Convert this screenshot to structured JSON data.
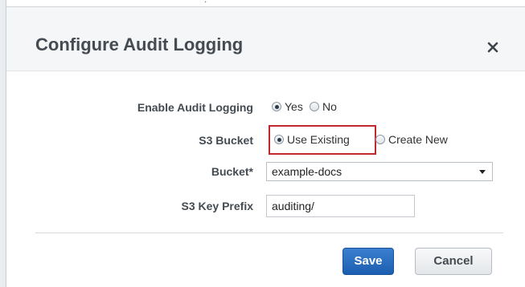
{
  "backdrop": {
    "partial_text": "- -. ---- ----"
  },
  "dialog": {
    "title": "Configure Audit Logging",
    "close_label": "×"
  },
  "form": {
    "enable_audit_logging": {
      "label": "Enable Audit Logging",
      "options": [
        {
          "label": "Yes",
          "checked": true
        },
        {
          "label": "No",
          "checked": false
        }
      ]
    },
    "s3_bucket": {
      "label": "S3 Bucket",
      "options": [
        {
          "label": "Use Existing",
          "checked": true
        },
        {
          "label": "Create New",
          "checked": false
        }
      ]
    },
    "bucket": {
      "label": "Bucket*",
      "selected": "example-docs"
    },
    "s3_key_prefix": {
      "label": "S3 Key Prefix",
      "value": "auditing/"
    }
  },
  "buttons": {
    "save_label": "Save",
    "cancel_label": "Cancel"
  },
  "colors": {
    "highlight": "#c1272d",
    "primary": "#1f63b3"
  }
}
